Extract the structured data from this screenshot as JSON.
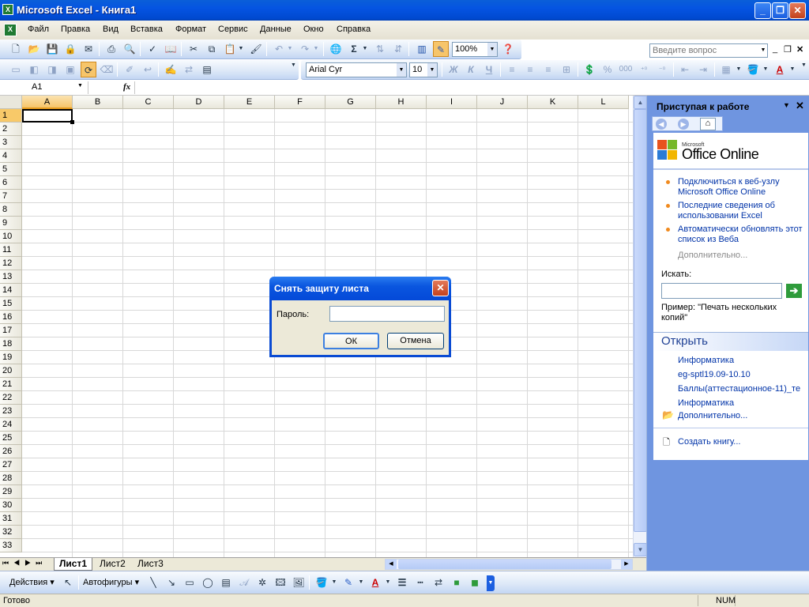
{
  "window": {
    "title": "Microsoft Excel - Книга1",
    "app_icon": "X"
  },
  "menu": {
    "items": [
      "Файл",
      "Правка",
      "Вид",
      "Вставка",
      "Формат",
      "Сервис",
      "Данные",
      "Окно",
      "Справка"
    ],
    "ask_placeholder": "Введите вопрос"
  },
  "toolbar": {
    "zoom": "100%",
    "font_name": "Arial Cyr",
    "font_size": "10",
    "bold": "Ж",
    "italic": "К",
    "underline": "Ч",
    "percent": "%",
    "thousands": "000"
  },
  "formula_bar": {
    "name_box": "A1",
    "fx": "fx"
  },
  "grid": {
    "columns": [
      "A",
      "B",
      "C",
      "D",
      "E",
      "F",
      "G",
      "H",
      "I",
      "J",
      "K",
      "L"
    ],
    "rows": [
      "1",
      "2",
      "3",
      "4",
      "5",
      "6",
      "7",
      "8",
      "9",
      "10",
      "11",
      "12",
      "13",
      "14",
      "15",
      "16",
      "17",
      "18",
      "19",
      "20",
      "21",
      "22",
      "23",
      "24",
      "25",
      "26",
      "27",
      "28",
      "29",
      "30",
      "31",
      "32",
      "33"
    ],
    "selected_cell": "A1"
  },
  "sheet_tabs": [
    "Лист1",
    "Лист2",
    "Лист3"
  ],
  "drawing_toolbar": {
    "actions": "Действия",
    "autoshapes": "Автофигуры"
  },
  "status": {
    "left": "Готово",
    "num": "NUM"
  },
  "task_pane": {
    "title": "Приступая к работе",
    "brand_small": "Microsoft",
    "brand": "Office Online",
    "links": [
      "Подключиться к веб-узлу Microsoft Office Online",
      "Последние сведения об использовании Excel",
      "Автоматически обновлять этот список из Веба"
    ],
    "more": "Дополнительно...",
    "search_label": "Искать:",
    "example": "Пример: \"Печать нескольких копий\"",
    "open_header": "Открыть",
    "recent_files": [
      "Информатика",
      "eg-sptl19.09-10.10",
      "Баллы(аттестационное-11)_те",
      "Информатика"
    ],
    "open_more": "Дополнительно...",
    "create": "Создать книгу..."
  },
  "dialog": {
    "title": "Снять защиту листа",
    "password_label": "Пароль:",
    "password_value": "",
    "ok": "ОК",
    "cancel": "Отмена"
  }
}
